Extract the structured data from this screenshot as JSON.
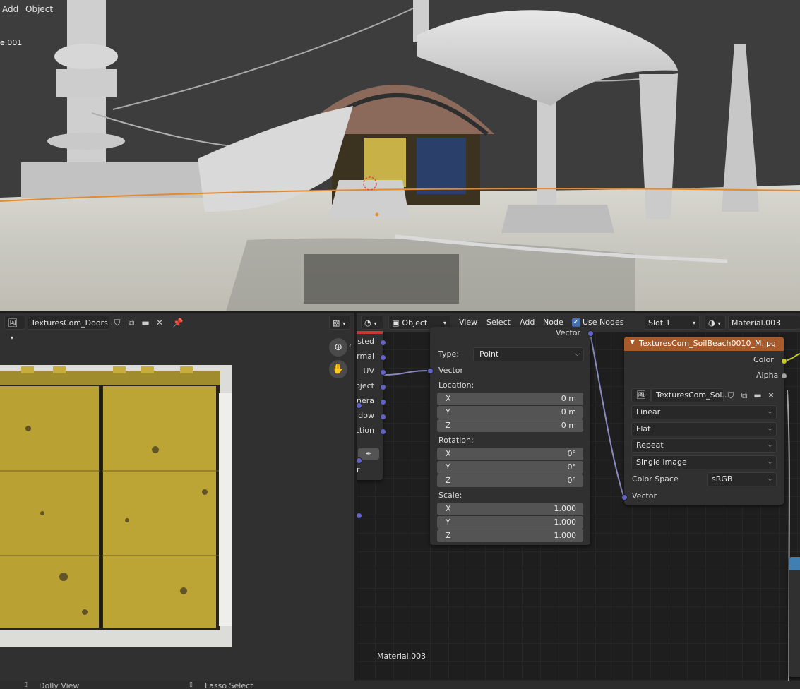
{
  "viewport": {
    "menu": [
      "Add",
      "Object"
    ],
    "object_label": "e.001"
  },
  "image_editor": {
    "image_name": "TexturesCom_Doors...",
    "tools": {
      "zoom": "zoom-icon",
      "pan": "hand-icon"
    }
  },
  "node_editor": {
    "header": {
      "mode": "Object",
      "menus": [
        "View",
        "Select",
        "Add",
        "Node"
      ],
      "use_nodes_label": "Use Nodes",
      "use_nodes_checked": true,
      "slot": "Slot 1",
      "material": "Material.003"
    },
    "texcoord_outputs": [
      "sted",
      "rmal",
      "UV",
      "bject",
      "nera",
      "dow",
      "ction"
    ],
    "texcoord_partial_label": "r",
    "mapping_node": {
      "top_output": "Vector",
      "type_label": "Type:",
      "type_value": "Point",
      "input_vector": "Vector",
      "location_label": "Location:",
      "location": [
        {
          "k": "X",
          "v": "0 m"
        },
        {
          "k": "Y",
          "v": "0 m"
        },
        {
          "k": "Z",
          "v": "0 m"
        }
      ],
      "rotation_label": "Rotation:",
      "rotation": [
        {
          "k": "X",
          "v": "0°"
        },
        {
          "k": "Y",
          "v": "0°"
        },
        {
          "k": "Z",
          "v": "0°"
        }
      ],
      "scale_label": "Scale:",
      "scale": [
        {
          "k": "X",
          "v": "1.000"
        },
        {
          "k": "Y",
          "v": "1.000"
        },
        {
          "k": "Z",
          "v": "1.000"
        }
      ]
    },
    "image_node": {
      "title": "TexturesCom_SoilBeach0010_M.jpg",
      "outputs": [
        "Color",
        "Alpha"
      ],
      "image_field": "TexturesCom_Soi...",
      "interpolation": "Linear",
      "projection": "Flat",
      "extension": "Repeat",
      "source": "Single Image",
      "color_space_label": "Color Space",
      "color_space": "sRGB",
      "input_vector": "Vector"
    },
    "footer_material": "Material.003",
    "colors": {
      "image_node_header": "#a85a2a",
      "socket_vector": "#6363c7",
      "socket_color": "#c7c729"
    }
  },
  "statusbar": {
    "left": "Dolly View",
    "right": "Lasso Select"
  }
}
